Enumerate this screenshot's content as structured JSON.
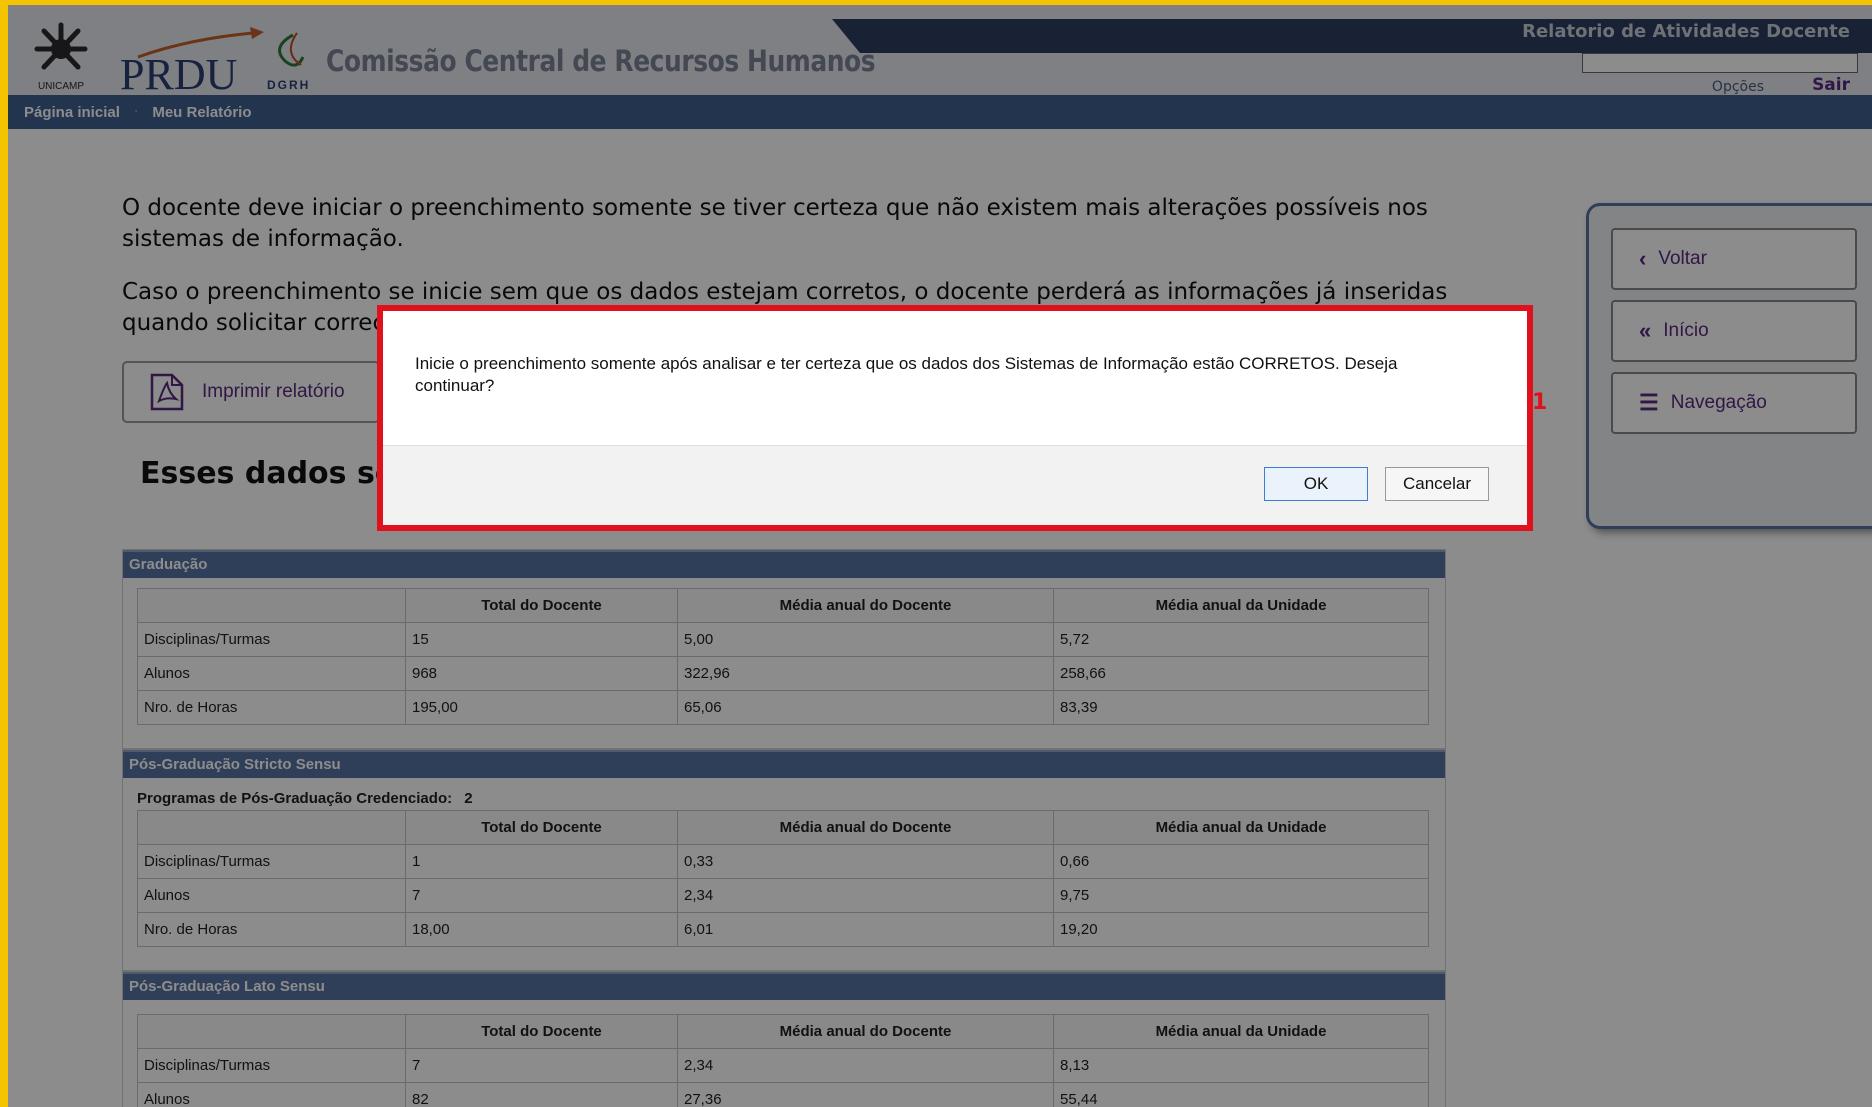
{
  "header": {
    "logo_unicamp": "UNICAMP",
    "logo_prdu": "PRDU",
    "logo_dgrh": "DGRH",
    "site_title": "Comissão Central de Recursos Humanos",
    "app_title": "Relatorio de Atividades Docente",
    "options_link": "Opções",
    "logout_link": "Sair"
  },
  "nav": {
    "items": [
      {
        "label": "Página inicial"
      },
      {
        "label": "Meu Relatório"
      }
    ]
  },
  "main": {
    "intro_p1": "O docente deve iniciar o preenchimento somente se tiver certeza que não existem mais alterações possíveis nos sistemas de informação.",
    "intro_p2": "Caso o preenchimento se inicie sem que os dados estejam corretos, o docente perderá as informações já inseridas quando solicitar correç",
    "print_button": "Imprimir relatório",
    "section_heading": "Esses dados será"
  },
  "tables": {
    "columns": [
      "",
      "Total do Docente",
      "Média anual do Docente",
      "Média anual da Unidade"
    ],
    "graduacao": {
      "title": "Graduação",
      "rows": [
        [
          "Disciplinas/Turmas",
          "15",
          "5,00",
          "5,72"
        ],
        [
          "Alunos",
          "968",
          "322,96",
          "258,66"
        ],
        [
          "Nro. de Horas",
          "195,00",
          "65,06",
          "83,39"
        ]
      ]
    },
    "stricto": {
      "title": "Pós-Graduação Stricto Sensu",
      "programs_label": "Programas de Pós-Graduação Credenciado:",
      "programs_value": "2",
      "rows": [
        [
          "Disciplinas/Turmas",
          "1",
          "0,33",
          "0,66"
        ],
        [
          "Alunos",
          "7",
          "2,34",
          "9,75"
        ],
        [
          "Nro. de Horas",
          "18,00",
          "6,01",
          "19,20"
        ]
      ]
    },
    "lato": {
      "title": "Pós-Graduação Lato Sensu",
      "rows": [
        [
          "Disciplinas/Turmas",
          "7",
          "2,34",
          "8,13"
        ],
        [
          "Alunos",
          "82",
          "27,36",
          "55,44"
        ]
      ]
    }
  },
  "side_panel": {
    "voltar": "Voltar",
    "inicio": "Início",
    "navegacao": "Navegação"
  },
  "dialog": {
    "message": "Inicie o preenchimento somente após analisar e ter certeza que os dados dos Sistemas de Informação estão CORRETOS. Deseja continuar?",
    "ok": "OK",
    "cancel": "Cancelar",
    "annotation": "1"
  },
  "colors": {
    "navbar": "#3f5f8e",
    "accent_purple": "#5a2a80",
    "highlight_red": "#e0101c",
    "frame_yellow": "#f5c400"
  }
}
